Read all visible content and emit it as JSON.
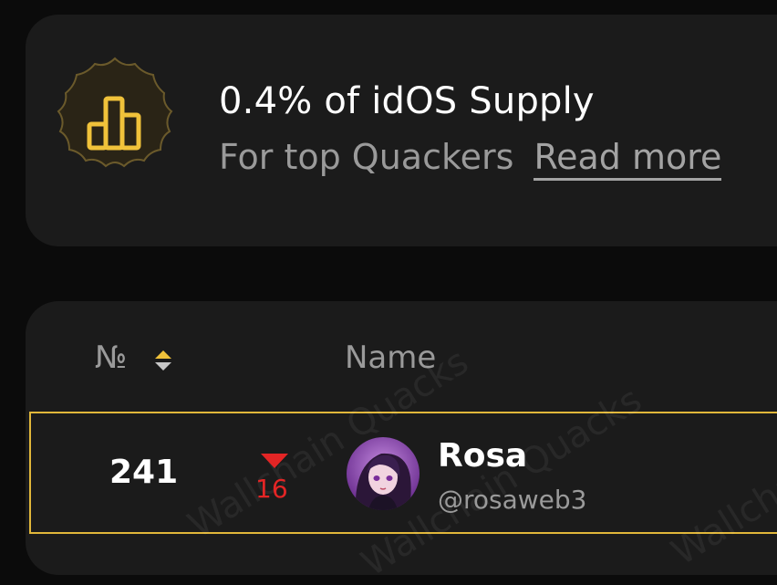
{
  "promo": {
    "title": "0.4% of idOS Supply",
    "subtitle": "For top Quackers",
    "link_label": "Read more",
    "icon": "bar-chart-icon",
    "accent_color": "#f0c23a"
  },
  "leaderboard": {
    "columns": {
      "number": "№",
      "name": "Name"
    },
    "sort_icon": "sort-icon",
    "watermark": "Wallchain Quacks",
    "highlighted_row": {
      "rank": "241",
      "change": "16",
      "change_direction": "down",
      "change_color": "#e32525",
      "avatar": "avatar-image",
      "name": "Rosa",
      "handle": "@rosaweb3",
      "border_color": "#e1b73a"
    }
  }
}
